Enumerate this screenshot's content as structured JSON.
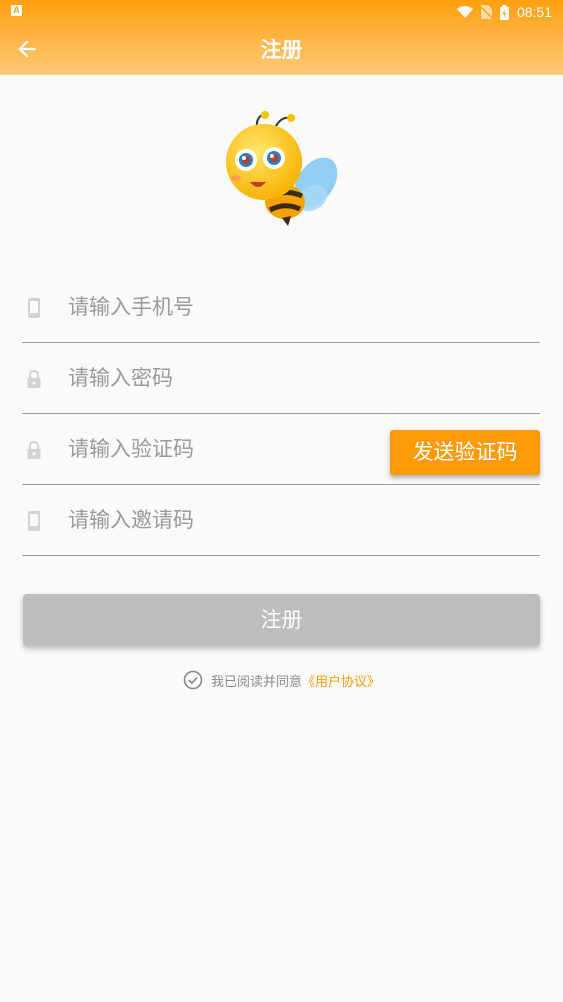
{
  "status_bar": {
    "time": "08:51",
    "app_badge": "A"
  },
  "appbar": {
    "title": "注册"
  },
  "form": {
    "phone_placeholder": "请输入手机号",
    "password_placeholder": "请输入密码",
    "code_placeholder": "请输入验证码",
    "invite_placeholder": "请输入邀请码",
    "send_code_label": "发送验证码"
  },
  "register_label": "注册",
  "agreement": {
    "prefix": "我已阅读并同意",
    "link": "《用户协议》"
  },
  "colors": {
    "accent": "#ff9a0a",
    "header_top": "#ff9f0e",
    "header_bottom": "#ffc97a",
    "disabled_button": "#bdbdbd"
  },
  "icons": [
    "back-arrow-icon",
    "phone-icon",
    "lock-icon",
    "check-circle-icon",
    "wifi-icon",
    "battery-icon",
    "bee-mascot"
  ]
}
